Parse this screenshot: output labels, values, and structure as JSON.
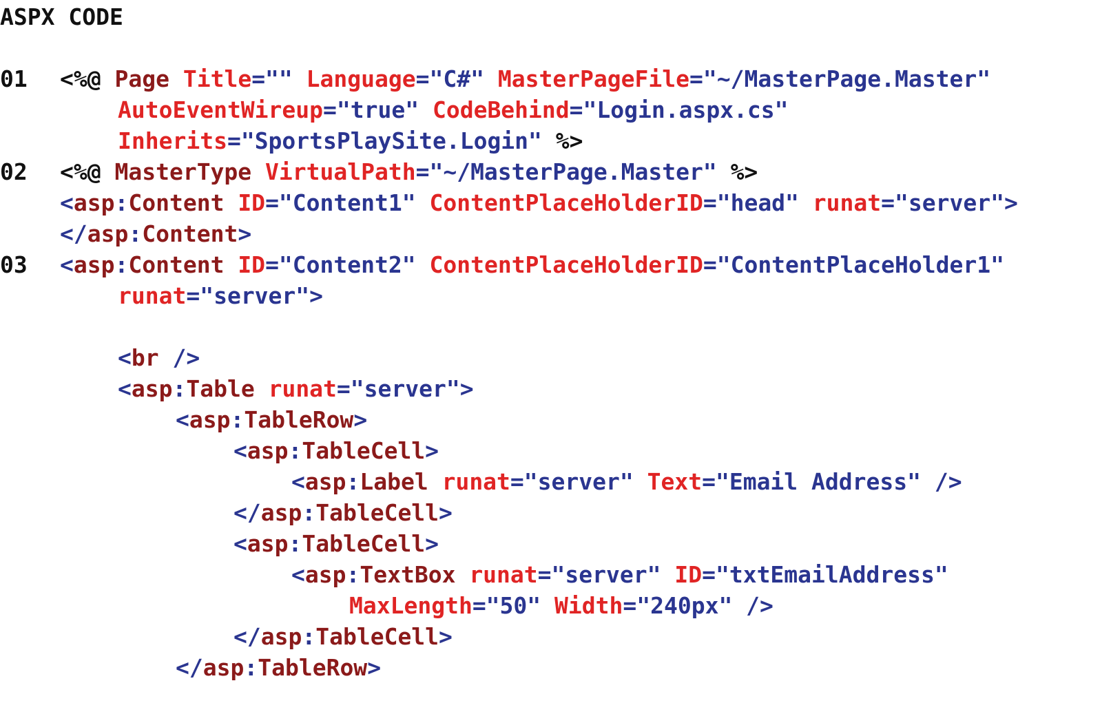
{
  "heading": "ASPX CODE",
  "colors": {
    "directive": "#111111",
    "keyword": "#8B1A1A",
    "attribute": "#E02424",
    "value": "#2A3590",
    "punctuation": "#2A3590",
    "plain": "#111111"
  },
  "lines": [
    {
      "number": "01",
      "indent": 0,
      "tokens": [
        {
          "t": "<%@ ",
          "c": "dir"
        },
        {
          "t": "Page",
          "c": "kw"
        },
        {
          "t": " ",
          "c": "plain"
        },
        {
          "t": "Title",
          "c": "attr"
        },
        {
          "t": "=\"\" ",
          "c": "val"
        },
        {
          "t": "Language",
          "c": "attr"
        },
        {
          "t": "=\"C#\" ",
          "c": "val"
        },
        {
          "t": "MasterPageFile",
          "c": "attr"
        },
        {
          "t": "=\"~/MasterPage.Master\"",
          "c": "val"
        }
      ]
    },
    {
      "number": "",
      "indent": 1,
      "tokens": [
        {
          "t": "AutoEventWireup",
          "c": "attr"
        },
        {
          "t": "=\"true\" ",
          "c": "val"
        },
        {
          "t": "CodeBehind",
          "c": "attr"
        },
        {
          "t": "=\"Login.aspx.cs\"",
          "c": "val"
        }
      ]
    },
    {
      "number": "",
      "indent": 1,
      "tokens": [
        {
          "t": "Inherits",
          "c": "attr"
        },
        {
          "t": "=\"SportsPlaySite.Login\" ",
          "c": "val"
        },
        {
          "t": "%>",
          "c": "dir"
        }
      ]
    },
    {
      "number": "02",
      "indent": 0,
      "tokens": [
        {
          "t": "<%@ ",
          "c": "dir"
        },
        {
          "t": "MasterType",
          "c": "kw"
        },
        {
          "t": " ",
          "c": "plain"
        },
        {
          "t": "VirtualPath",
          "c": "attr"
        },
        {
          "t": "=\"~/MasterPage.Master\" ",
          "c": "val"
        },
        {
          "t": "%>",
          "c": "dir"
        }
      ]
    },
    {
      "number": "",
      "indent": 0,
      "tokens": [
        {
          "t": "<",
          "c": "punc"
        },
        {
          "t": "asp",
          "c": "kw"
        },
        {
          "t": ":",
          "c": "punc"
        },
        {
          "t": "Content",
          "c": "kw"
        },
        {
          "t": " ",
          "c": "plain"
        },
        {
          "t": "ID",
          "c": "attr"
        },
        {
          "t": "=\"Content1\" ",
          "c": "val"
        },
        {
          "t": "ContentPlaceHolderID",
          "c": "attr"
        },
        {
          "t": "=\"head\" ",
          "c": "val"
        },
        {
          "t": "runat",
          "c": "attr"
        },
        {
          "t": "=\"server\">",
          "c": "val"
        }
      ]
    },
    {
      "number": "",
      "indent": 0,
      "tokens": [
        {
          "t": "</",
          "c": "punc"
        },
        {
          "t": "asp",
          "c": "kw"
        },
        {
          "t": ":",
          "c": "punc"
        },
        {
          "t": "Content",
          "c": "kw"
        },
        {
          "t": ">",
          "c": "punc"
        }
      ]
    },
    {
      "number": "03",
      "indent": 0,
      "tokens": [
        {
          "t": "<",
          "c": "punc"
        },
        {
          "t": "asp",
          "c": "kw"
        },
        {
          "t": ":",
          "c": "punc"
        },
        {
          "t": "Content",
          "c": "kw"
        },
        {
          "t": " ",
          "c": "plain"
        },
        {
          "t": "ID",
          "c": "attr"
        },
        {
          "t": "=\"Content2\" ",
          "c": "val"
        },
        {
          "t": "ContentPlaceHolderID",
          "c": "attr"
        },
        {
          "t": "=\"ContentPlaceHolder1\"",
          "c": "val"
        }
      ]
    },
    {
      "number": "",
      "indent": 1,
      "tokens": [
        {
          "t": "runat",
          "c": "attr"
        },
        {
          "t": "=\"server\">",
          "c": "val"
        }
      ]
    },
    {
      "number": "",
      "indent": 0,
      "tokens": []
    },
    {
      "number": "",
      "indent": 1,
      "tokens": [
        {
          "t": "<",
          "c": "punc"
        },
        {
          "t": "br",
          "c": "kw"
        },
        {
          "t": " />",
          "c": "punc"
        }
      ]
    },
    {
      "number": "",
      "indent": 1,
      "tokens": [
        {
          "t": "<",
          "c": "punc"
        },
        {
          "t": "asp",
          "c": "kw"
        },
        {
          "t": ":",
          "c": "punc"
        },
        {
          "t": "Table",
          "c": "kw"
        },
        {
          "t": " ",
          "c": "plain"
        },
        {
          "t": "runat",
          "c": "attr"
        },
        {
          "t": "=\"server\">",
          "c": "val"
        }
      ]
    },
    {
      "number": "",
      "indent": 2,
      "tokens": [
        {
          "t": "<",
          "c": "punc"
        },
        {
          "t": "asp",
          "c": "kw"
        },
        {
          "t": ":",
          "c": "punc"
        },
        {
          "t": "TableRow",
          "c": "kw"
        },
        {
          "t": ">",
          "c": "punc"
        }
      ]
    },
    {
      "number": "",
      "indent": 3,
      "tokens": [
        {
          "t": "<",
          "c": "punc"
        },
        {
          "t": "asp",
          "c": "kw"
        },
        {
          "t": ":",
          "c": "punc"
        },
        {
          "t": "TableCell",
          "c": "kw"
        },
        {
          "t": ">",
          "c": "punc"
        }
      ]
    },
    {
      "number": "",
      "indent": 4,
      "tokens": [
        {
          "t": "<",
          "c": "punc"
        },
        {
          "t": "asp",
          "c": "kw"
        },
        {
          "t": ":",
          "c": "punc"
        },
        {
          "t": "Label",
          "c": "kw"
        },
        {
          "t": " ",
          "c": "plain"
        },
        {
          "t": "runat",
          "c": "attr"
        },
        {
          "t": "=\"server\" ",
          "c": "val"
        },
        {
          "t": "Text",
          "c": "attr"
        },
        {
          "t": "=\"Email Address\" />",
          "c": "val"
        }
      ]
    },
    {
      "number": "",
      "indent": 3,
      "tokens": [
        {
          "t": "</",
          "c": "punc"
        },
        {
          "t": "asp",
          "c": "kw"
        },
        {
          "t": ":",
          "c": "punc"
        },
        {
          "t": "TableCell",
          "c": "kw"
        },
        {
          "t": ">",
          "c": "punc"
        }
      ]
    },
    {
      "number": "",
      "indent": 3,
      "tokens": [
        {
          "t": "<",
          "c": "punc"
        },
        {
          "t": "asp",
          "c": "kw"
        },
        {
          "t": ":",
          "c": "punc"
        },
        {
          "t": "TableCell",
          "c": "kw"
        },
        {
          "t": ">",
          "c": "punc"
        }
      ]
    },
    {
      "number": "",
      "indent": 4,
      "tokens": [
        {
          "t": "<",
          "c": "punc"
        },
        {
          "t": "asp",
          "c": "kw"
        },
        {
          "t": ":",
          "c": "punc"
        },
        {
          "t": "TextBox",
          "c": "kw"
        },
        {
          "t": " ",
          "c": "plain"
        },
        {
          "t": "runat",
          "c": "attr"
        },
        {
          "t": "=\"server\" ",
          "c": "val"
        },
        {
          "t": "ID",
          "c": "attr"
        },
        {
          "t": "=\"txtEmailAddress\"",
          "c": "val"
        }
      ]
    },
    {
      "number": "",
      "indent": 5,
      "tokens": [
        {
          "t": "MaxLength",
          "c": "attr"
        },
        {
          "t": "=\"50\" ",
          "c": "val"
        },
        {
          "t": "Width",
          "c": "attr"
        },
        {
          "t": "=\"240px\" />",
          "c": "val"
        }
      ]
    },
    {
      "number": "",
      "indent": 3,
      "tokens": [
        {
          "t": "</",
          "c": "punc"
        },
        {
          "t": "asp",
          "c": "kw"
        },
        {
          "t": ":",
          "c": "punc"
        },
        {
          "t": "TableCell",
          "c": "kw"
        },
        {
          "t": ">",
          "c": "punc"
        }
      ]
    },
    {
      "number": "",
      "indent": 2,
      "tokens": [
        {
          "t": "</",
          "c": "punc"
        },
        {
          "t": "asp",
          "c": "kw"
        },
        {
          "t": ":",
          "c": "punc"
        },
        {
          "t": "TableRow",
          "c": "kw"
        },
        {
          "t": ">",
          "c": "punc"
        }
      ]
    }
  ]
}
